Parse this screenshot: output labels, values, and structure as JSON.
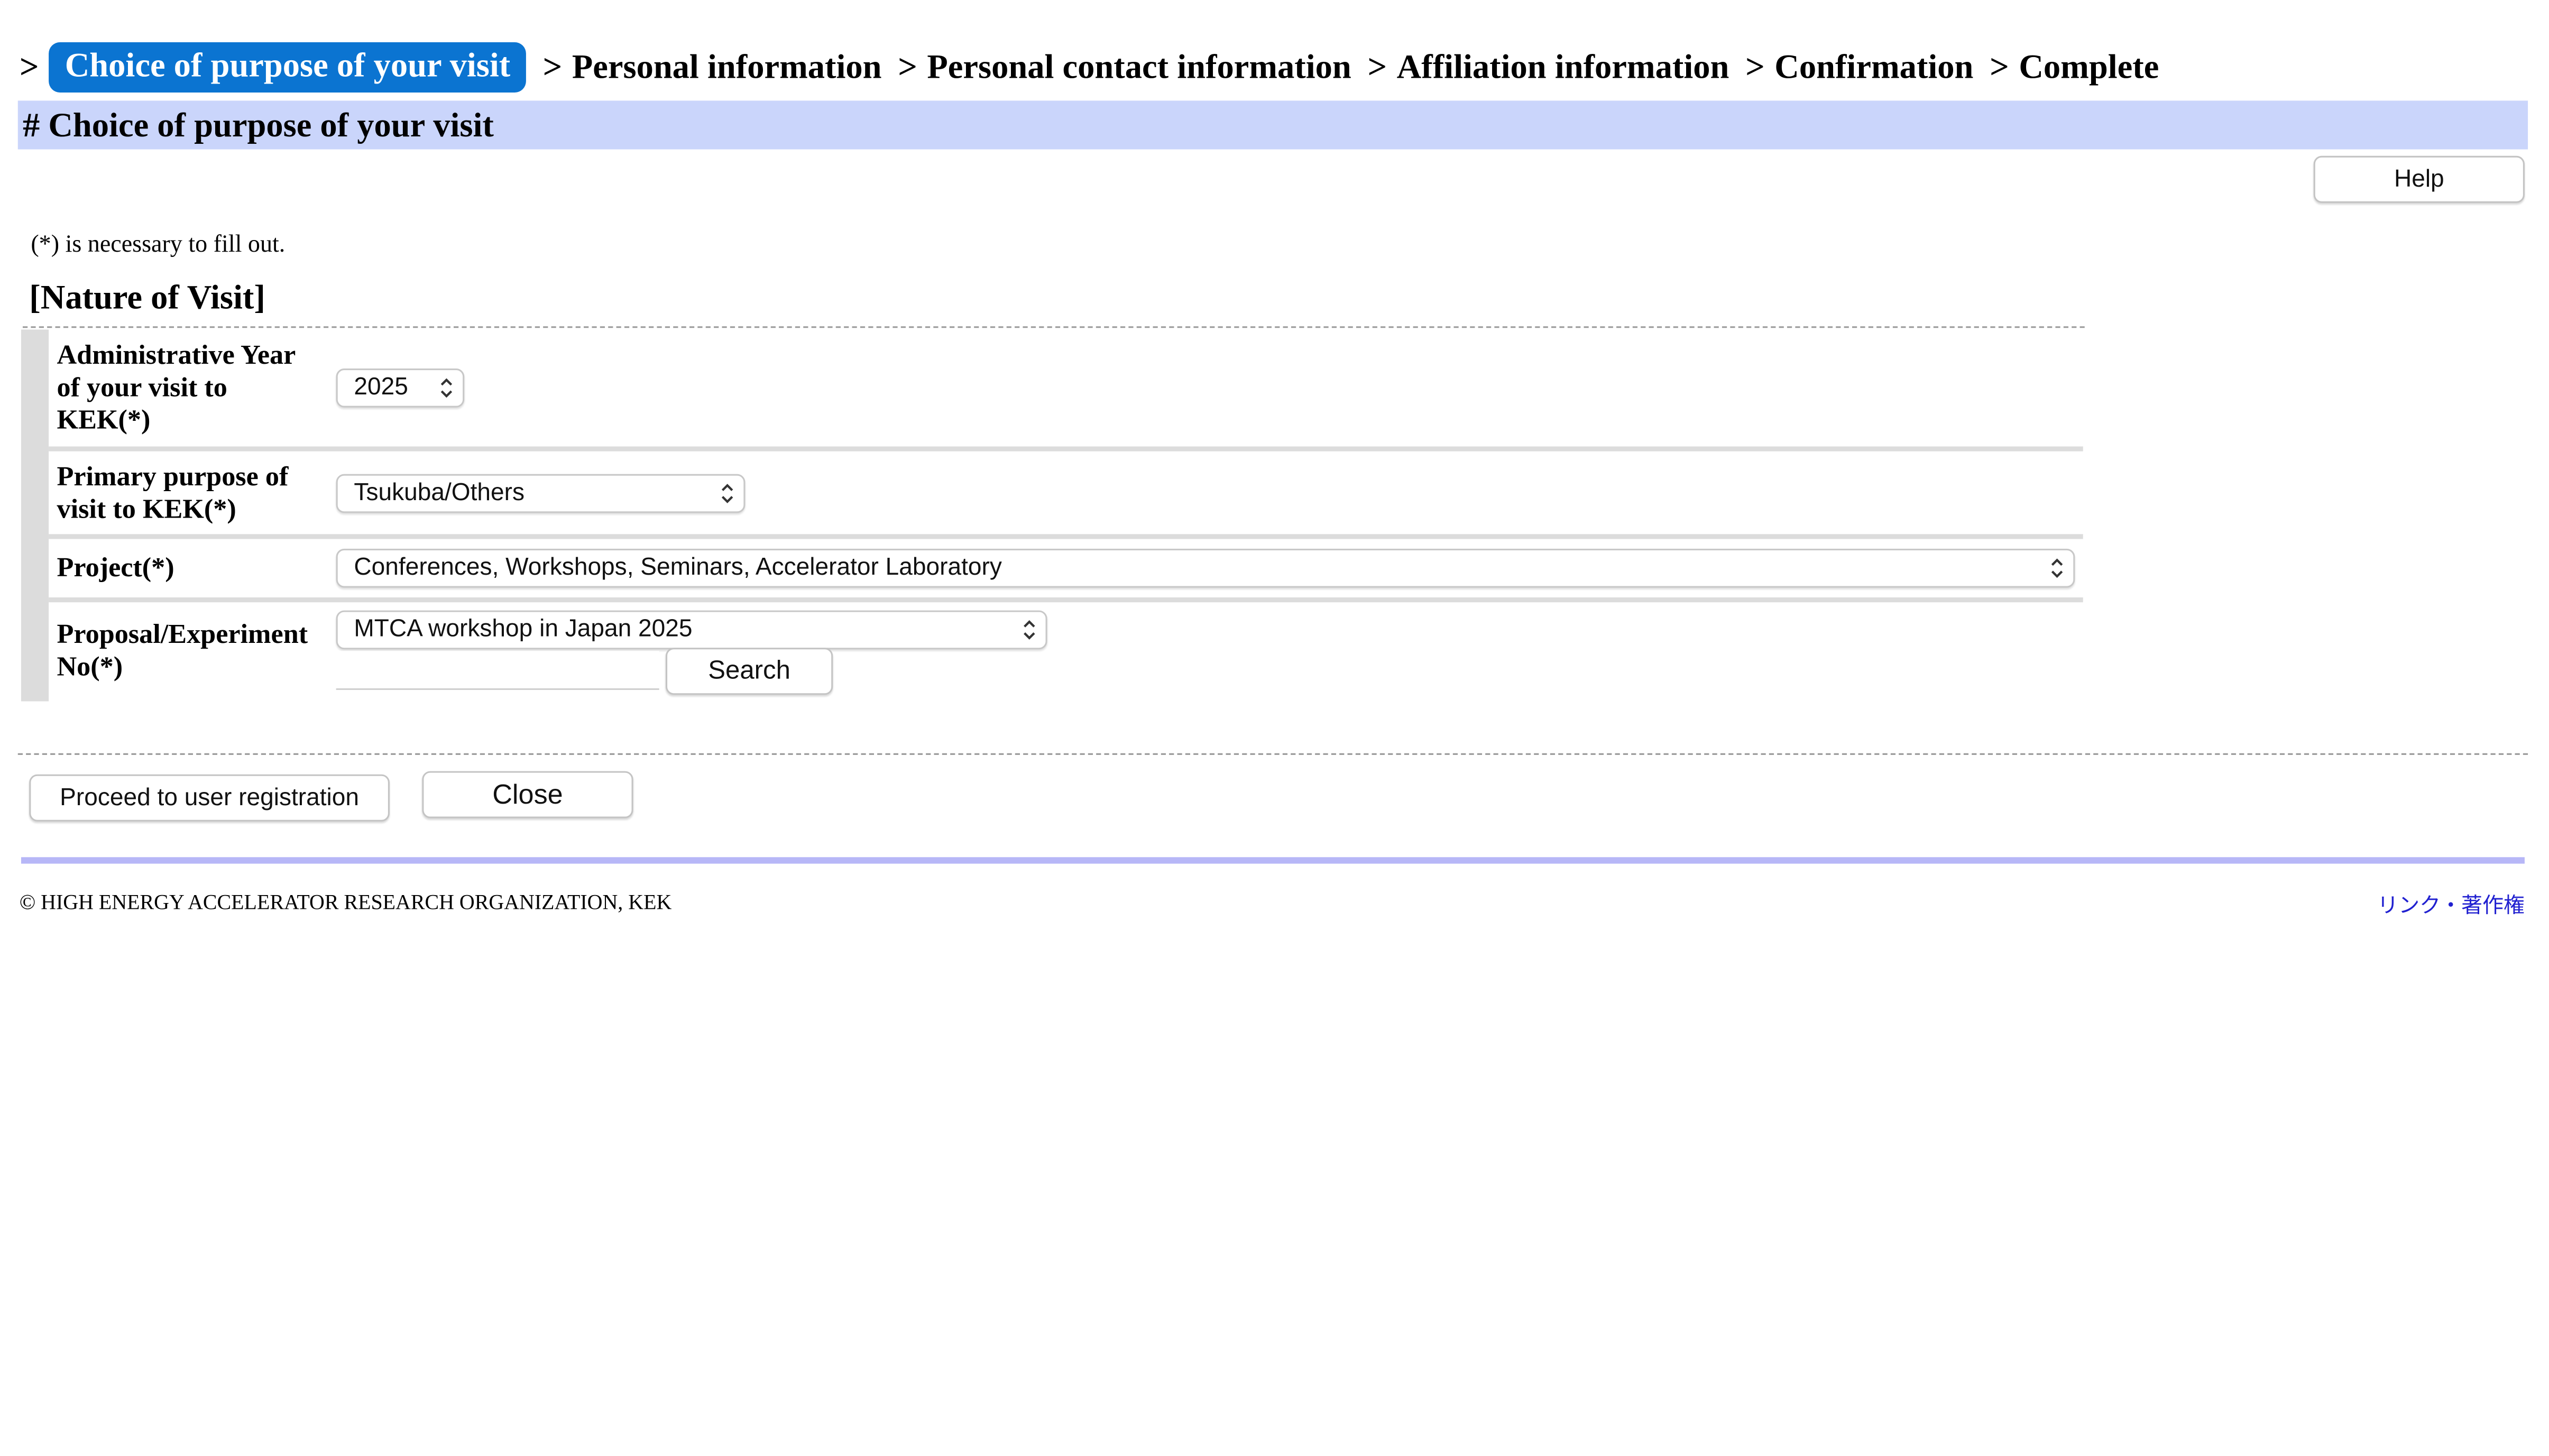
{
  "steps": [
    {
      "arrow": ">",
      "label": "Choice of purpose of your visit",
      "active": true
    },
    {
      "arrow": ">",
      "label": "Personal information"
    },
    {
      "arrow": ">",
      "label": "Personal contact information"
    },
    {
      "arrow": ">",
      "label": "Affiliation information"
    },
    {
      "arrow": ">",
      "label": "Confirmation"
    },
    {
      "arrow": ">",
      "label": "Complete"
    }
  ],
  "section_title": "# Choice of purpose of your visit",
  "help_label": "Help",
  "required_note": "(*) is necessary to fill out.",
  "group_title": "[Nature of Visit]",
  "form": {
    "year": {
      "label": "Administrative Year of your visit to KEK(*)",
      "value": "2025"
    },
    "purpose": {
      "label": "Primary purpose of visit to KEK(*)",
      "value": "Tsukuba/Others"
    },
    "project": {
      "label": "Project(*)",
      "value": "Conferences, Workshops, Seminars, Accelerator Laboratory"
    },
    "proposal": {
      "label": "Proposal/Experiment No(*)",
      "value": "MTCA workshop in Japan 2025",
      "search_value": "",
      "search_label": "Search"
    }
  },
  "actions": {
    "proceed_label": "Proceed to user registration",
    "close_label": "Close"
  },
  "footer": {
    "copyright": "© HIGH ENERGY ACCELERATOR RESEARCH ORGANIZATION, KEK",
    "link": "リンク・著作権"
  },
  "colors": {
    "active_step": "#0b74d1",
    "section_header_bg": "#cad5fb",
    "footer_rule": "#b7b7f7",
    "link": "#2020d0"
  },
  "icons": {
    "select_arrow": "chevron-updown-icon"
  }
}
